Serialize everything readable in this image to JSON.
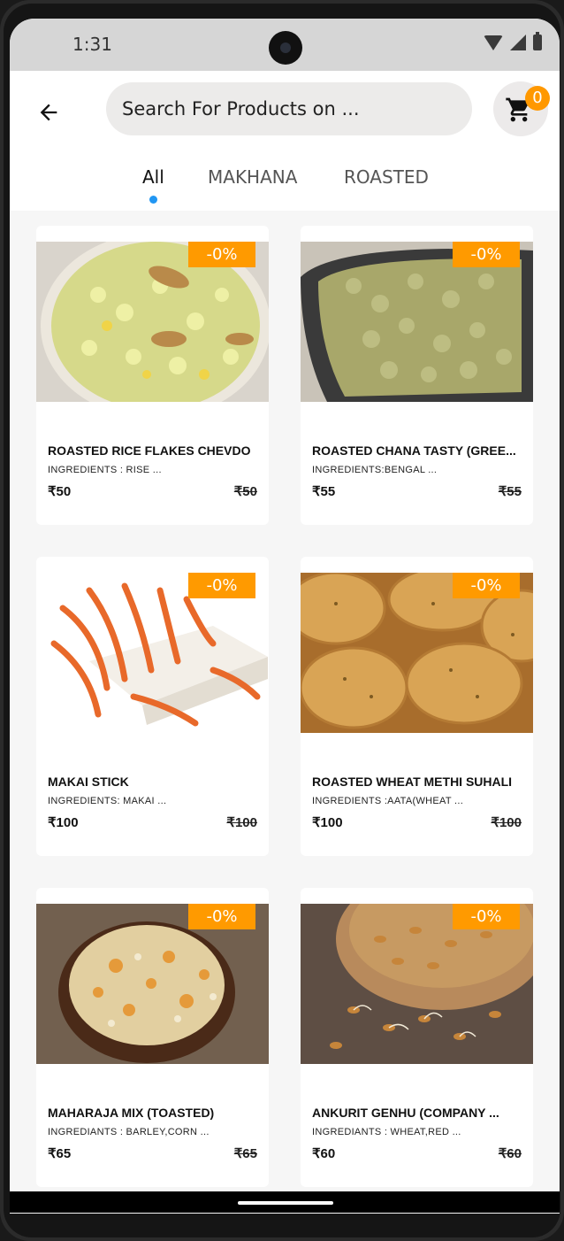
{
  "status": {
    "time": "1:31"
  },
  "search": {
    "placeholder": "Search For Products on ..."
  },
  "cart": {
    "count": "0"
  },
  "tabs": [
    {
      "label": "All"
    },
    {
      "label": "MAKHANA"
    },
    {
      "label": "ROASTED"
    }
  ],
  "products": [
    {
      "title": "ROASTED RICE FLAKES CHEVDO",
      "ingredients": "INGREDIENTS : RISE ...",
      "price": "₹50",
      "mrp": "₹50",
      "discount": "-0%"
    },
    {
      "title": "ROASTED CHANA TASTY (GREE...",
      "ingredients": "INGREDIENTS:BENGAL ...",
      "price": "₹55",
      "mrp": "₹55",
      "discount": "-0%"
    },
    {
      "title": "MAKAI STICK",
      "ingredients": "INGREDIENTS: MAKAI ...",
      "price": "₹100",
      "mrp": "₹100",
      "discount": "-0%"
    },
    {
      "title": "ROASTED WHEAT METHI SUHALI",
      "ingredients": "INGREDIENTS :AATA(WHEAT ...",
      "price": "₹100",
      "mrp": "₹100",
      "discount": "-0%"
    },
    {
      "title": "MAHARAJA MIX (TOASTED)",
      "ingredients": "INGREDIANTS : BARLEY,CORN ...",
      "price": "₹65",
      "mrp": "₹65",
      "discount": "-0%"
    },
    {
      "title": "ANKURIT GENHU (COMPANY ...",
      "ingredients": "INGREDIANTS : WHEAT,RED ...",
      "price": "₹60",
      "mrp": "₹60",
      "discount": "-0%"
    }
  ],
  "colors": {
    "accent": "#ff9a00",
    "tab_indicator": "#2196f3"
  }
}
